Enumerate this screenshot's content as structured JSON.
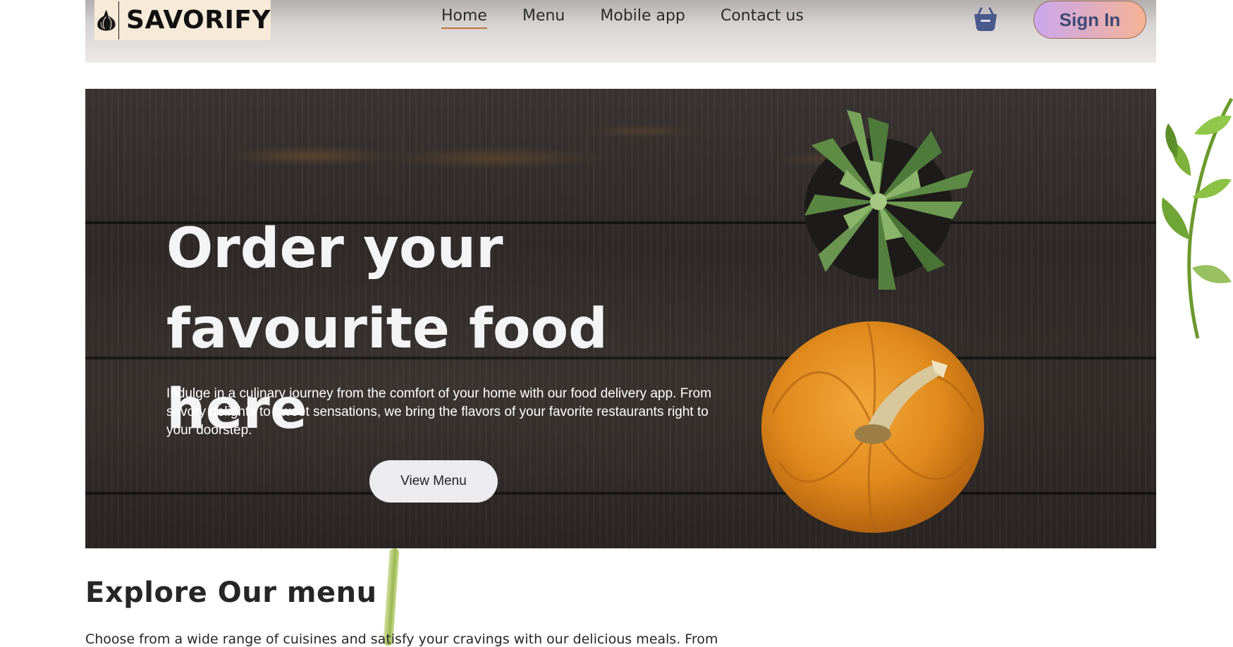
{
  "brand": {
    "name": "SAVORIFY",
    "logo_icon": "garlic-icon",
    "logo_bg": "#f7ead8"
  },
  "nav": {
    "links": [
      {
        "label": "Home",
        "active": true
      },
      {
        "label": "Menu",
        "active": false
      },
      {
        "label": "Mobile app",
        "active": false
      },
      {
        "label": "Contact us",
        "active": false
      }
    ],
    "active_underline_color": "#c0753f",
    "cart_icon": "shopping-basket-icon",
    "cart_color": "#4b5a8c",
    "signin_label": "Sign In",
    "signin_gradient": [
      "#caa7ee",
      "#f5b394"
    ]
  },
  "hero": {
    "title_line1": "Order your",
    "title_line2": "favourite food here",
    "description": "Indulge in a culinary journey from the comfort of your home with our food delivery app. From savory delights to sweet sensations, we bring the flavors of your favorite restaurants right to your doorstep.",
    "button_label": "View Menu",
    "decor": [
      "succulent-plant",
      "pumpkin"
    ]
  },
  "explore": {
    "title": "Explore Our menu",
    "text": "Choose from a wide range of cuisines and satisfy your cravings with our delicious meals. From"
  }
}
